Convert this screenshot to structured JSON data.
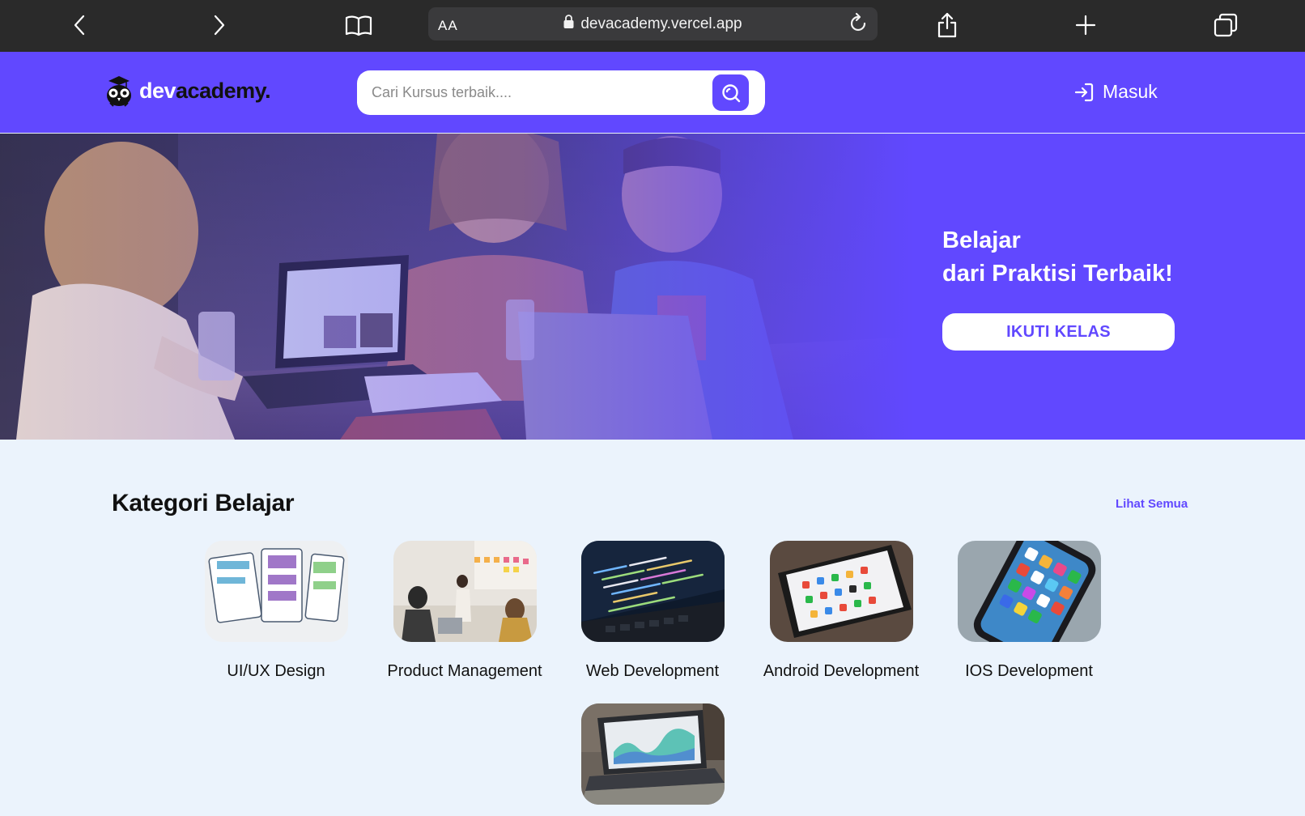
{
  "browser": {
    "url": "devacademy.vercel.app",
    "reader_label": "AA",
    "icons": [
      "chevron-left-icon",
      "chevron-right-icon",
      "book-icon",
      "lock-icon",
      "reload-icon",
      "share-icon",
      "plus-icon",
      "tabs-icon"
    ]
  },
  "header": {
    "logo_dev": "dev",
    "logo_academy": "academy.",
    "search_placeholder": "Cari Kursus terbaik....",
    "login_label": "Masuk"
  },
  "hero": {
    "line1": "Belajar",
    "line2": "dari Praktisi Terbaik!",
    "cta_label": "IKUTI KELAS"
  },
  "categories": {
    "title": "Kategori Belajar",
    "see_all": "Lihat Semua",
    "items": [
      {
        "label": "UI/UX Design"
      },
      {
        "label": "Product Management"
      },
      {
        "label": "Web Development"
      },
      {
        "label": "Android Development"
      },
      {
        "label": "IOS Development"
      },
      {
        "label": ""
      }
    ]
  },
  "colors": {
    "brand": "#6148ff",
    "page_bg": "#ebf3fc",
    "browser_bar": "#2a2a2a"
  }
}
